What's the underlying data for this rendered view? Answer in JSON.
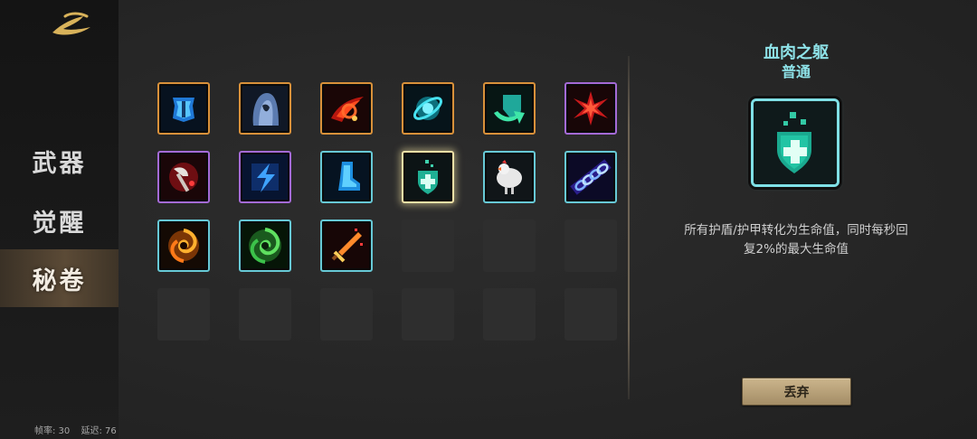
{
  "sidebar": {
    "tabs": [
      {
        "label": "武器",
        "active": false
      },
      {
        "label": "觉醒",
        "active": false
      },
      {
        "label": "秘卷",
        "active": true
      }
    ],
    "stats": {
      "fps": "帧率: 30",
      "latency": "延迟: 76"
    }
  },
  "grid": {
    "rows": [
      [
        {
          "icon": "armor-icon",
          "rarity": "orange"
        },
        {
          "icon": "hooded-cloak-icon",
          "rarity": "orange"
        },
        {
          "icon": "fire-slash-icon",
          "rarity": "orange"
        },
        {
          "icon": "orbit-ring-icon",
          "rarity": "orange"
        },
        {
          "icon": "shield-heal-arrow-icon",
          "rarity": "orange"
        },
        {
          "icon": "red-burst-icon",
          "rarity": "purple"
        }
      ],
      [
        {
          "icon": "axe-blood-icon",
          "rarity": "purple"
        },
        {
          "icon": "lightning-icon",
          "rarity": "purple"
        },
        {
          "icon": "boot-icon",
          "rarity": "teal"
        },
        {
          "icon": "shield-cross-icon",
          "rarity": "teal",
          "selected": true
        },
        {
          "icon": "chicken-icon",
          "rarity": "teal"
        },
        {
          "icon": "chain-icon",
          "rarity": "teal"
        }
      ],
      [
        {
          "icon": "fire-vortex-icon",
          "rarity": "teal"
        },
        {
          "icon": "green-vortex-icon",
          "rarity": "teal"
        },
        {
          "icon": "flame-sword-icon",
          "rarity": "teal"
        },
        {
          "icon": "empty",
          "rarity": "none"
        },
        {
          "icon": "empty",
          "rarity": "none"
        },
        {
          "icon": "empty",
          "rarity": "none"
        }
      ],
      [
        {
          "icon": "empty",
          "rarity": "none"
        },
        {
          "icon": "empty",
          "rarity": "none"
        },
        {
          "icon": "empty",
          "rarity": "none"
        },
        {
          "icon": "empty",
          "rarity": "none"
        },
        {
          "icon": "empty",
          "rarity": "none"
        },
        {
          "icon": "empty",
          "rarity": "none"
        }
      ]
    ]
  },
  "detail": {
    "title": "血肉之躯",
    "rarity": "普通",
    "icon": "shield-cross-icon",
    "description_line1": "所有护盾/护甲转化为生命值，同时每秒回",
    "description_line2": "复2%的最大生命值",
    "discard_label": "丢弃"
  },
  "colors": {
    "rarity_orange": "#d9913a",
    "rarity_purple": "#a46ad6",
    "rarity_teal": "#67c9d6",
    "selected_glow": "#f0e0a6",
    "detail_text": "#8ee2e8",
    "button": "#b9a178"
  }
}
